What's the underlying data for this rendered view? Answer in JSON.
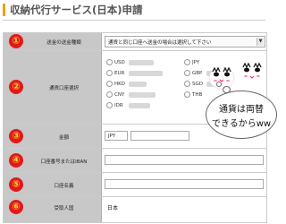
{
  "page": {
    "title": "収納代行サービス(日本)申請"
  },
  "rows": [
    {
      "num": "①",
      "label": "送金の送金種類"
    },
    {
      "num": "②",
      "label": "通貨口座選択"
    },
    {
      "num": "③",
      "label": "金額"
    },
    {
      "num": "④",
      "label": "口座番号またはIBAN"
    },
    {
      "num": "⑤",
      "label": "口座名義"
    },
    {
      "num": "⑥",
      "label": "受取人国"
    }
  ],
  "remit_select": {
    "value": "通貨と同じ口座へ送金の場合は選択して下さい",
    "arrow": "▼"
  },
  "currencies_left": [
    "USD",
    "EUR",
    "HKD",
    "CNY",
    "IDR"
  ],
  "currencies_right": [
    "JPY",
    "GBP",
    "SGD",
    "THB"
  ],
  "amount": {
    "currency": "JPY",
    "value": ""
  },
  "account_number": {
    "value": ""
  },
  "account_name": {
    "value": ""
  },
  "recipient_country": {
    "value": "日本"
  },
  "bubble": {
    "line1": "通貨は両替",
    "line2": "できるからww"
  },
  "colors": {
    "accent": "#e8a417",
    "number_bg": "#e11919",
    "number_fg": "#f4d433",
    "label_bg": "#c8c8c8"
  }
}
